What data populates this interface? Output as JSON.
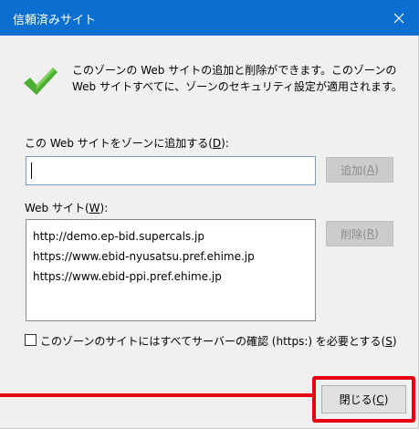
{
  "window": {
    "title": "信頼済みサイト",
    "close_glyph": "✕"
  },
  "info": {
    "text": "このゾーンの Web サイトの追加と削除ができます。このゾーンの Web サイトすべてに、ゾーンのセキュリティ設定が適用されます。",
    "icon": "check-icon",
    "icon_color": "#4caf32"
  },
  "add_section": {
    "label_prefix": "この Web サイトをゾーンに追加する(",
    "label_key": "D",
    "label_suffix": "):",
    "input_value": "",
    "add_button_label": "追加(",
    "add_button_key": "A",
    "add_button_suffix": ")"
  },
  "sites_section": {
    "label_prefix": "Web サイト(",
    "label_key": "W",
    "label_suffix": "):",
    "items": [
      "http://demo.ep-bid.supercals.jp",
      "https://www.ebid-nyusatsu.pref.ehime.jp",
      "https://www.ebid-ppi.pref.ehime.jp"
    ],
    "remove_button_label": "削除(",
    "remove_button_key": "R",
    "remove_button_suffix": ")"
  },
  "https_option": {
    "checked": false,
    "label_prefix": "このゾーンのサイトにはすべてサーバーの確認 (https:) を必要とする(",
    "label_key": "S",
    "label_suffix": ")"
  },
  "footer": {
    "close_button_label": "閉じる(",
    "close_button_key": "C",
    "close_button_suffix": ")"
  },
  "colors": {
    "titlebar": "#0a6fd0",
    "highlight": "#e60012"
  }
}
